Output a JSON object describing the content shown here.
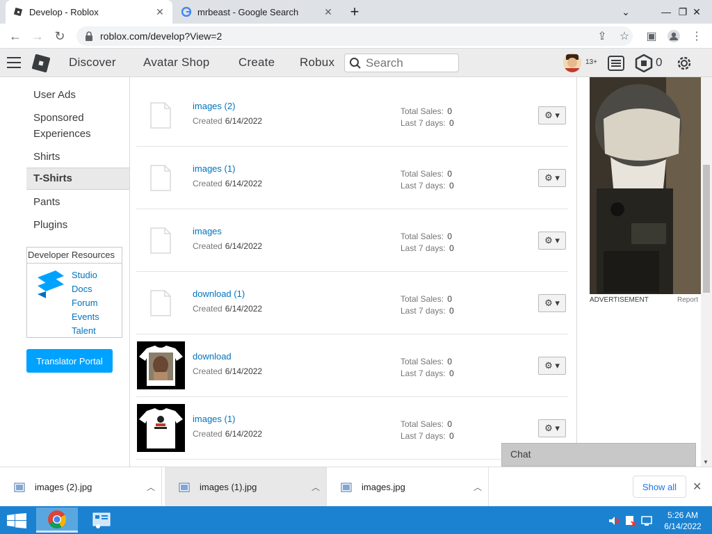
{
  "browser": {
    "tabs": [
      {
        "title": "Develop - Roblox",
        "active": true
      },
      {
        "title": "mrbeast - Google Search",
        "active": false
      }
    ],
    "url": "roblox.com/develop?View=2"
  },
  "header": {
    "nav": [
      "Discover",
      "Avatar Shop",
      "Create",
      "Robux"
    ],
    "search_placeholder": "Search",
    "age_label": "13+",
    "robux_count": "0"
  },
  "sidebar": {
    "items": [
      "User Ads",
      "Sponsored",
      "Experiences",
      "Shirts",
      "T-Shirts",
      "Pants",
      "Plugins"
    ],
    "active_item": "T-Shirts",
    "dev_resources": {
      "title": "Developer Resources",
      "links": [
        "Studio",
        "Docs",
        "Forum",
        "Events",
        "Talent"
      ]
    },
    "translator_button": "Translator Portal"
  },
  "list": {
    "created_label": "Created",
    "sales_label": "Total Sales:",
    "last7_label": "Last 7 days:",
    "rows": [
      {
        "name": "images (2)",
        "date": "6/14/2022",
        "total_sales": "0",
        "last7": "0",
        "thumb": "placeholder"
      },
      {
        "name": "images (1)",
        "date": "6/14/2022",
        "total_sales": "0",
        "last7": "0",
        "thumb": "placeholder"
      },
      {
        "name": "images",
        "date": "6/14/2022",
        "total_sales": "0",
        "last7": "0",
        "thumb": "placeholder"
      },
      {
        "name": "download (1)",
        "date": "6/14/2022",
        "total_sales": "0",
        "last7": "0",
        "thumb": "placeholder"
      },
      {
        "name": "download",
        "date": "6/14/2022",
        "total_sales": "0",
        "last7": "0",
        "thumb": "tshirt-face"
      },
      {
        "name": "images (1)",
        "date": "6/14/2022",
        "total_sales": "0",
        "last7": "0",
        "thumb": "tshirt-logo"
      }
    ]
  },
  "ad": {
    "label": "ADVERTISEMENT",
    "report": "Report"
  },
  "chat": {
    "label": "Chat"
  },
  "downloads": {
    "files": [
      "images (2).jpg",
      "images (1).jpg",
      "images.jpg"
    ],
    "show_all": "Show all"
  },
  "taskbar": {
    "time": "5:26 AM",
    "date": "6/14/2022"
  },
  "colors": {
    "link": "#0074bd",
    "primary_button": "#00a2ff",
    "taskbar": "#1b82d1"
  }
}
